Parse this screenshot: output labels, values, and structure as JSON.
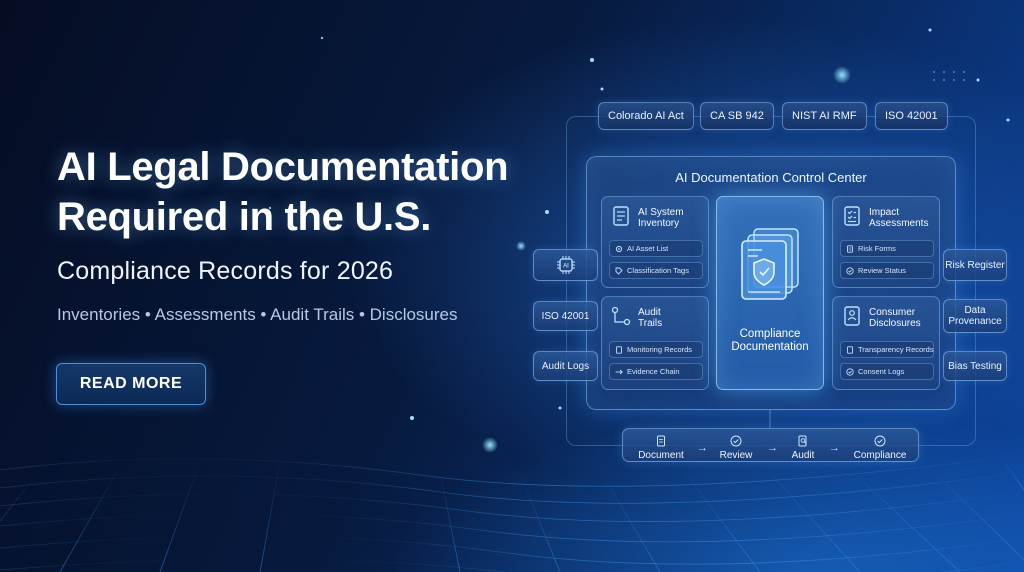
{
  "hero": {
    "title": "AI Legal Documentation Required in the U.S.",
    "subtitle": "Compliance Records for 2026",
    "topics": "Inventories • Assessments • Audit Trails • Disclosures",
    "cta_label": "READ MORE"
  },
  "top_chips": [
    "Colorado AI Act",
    "CA SB 942",
    "NIST AI RMF",
    "ISO 42001"
  ],
  "control_center": {
    "title": "AI Documentation Control Center",
    "cards": {
      "inventory": {
        "title": "AI System Inventory",
        "items": [
          "AI Asset List",
          "Classification Tags"
        ]
      },
      "audit": {
        "title": "Audit Trails",
        "items": [
          "Monitoring Records",
          "Evidence Chain"
        ]
      },
      "impact": {
        "title": "Impact Assessments",
        "items": [
          "Risk Forms",
          "Review Status"
        ]
      },
      "consumer": {
        "title": "Consumer Disclosures",
        "items": [
          "Transparency Records",
          "Consent Logs"
        ]
      }
    },
    "center_label": "Compliance Documentation"
  },
  "left_chips": {
    "chip_icon": "ai-chip-icon",
    "iso": "ISO 42001",
    "audit_logs": "Audit Logs"
  },
  "right_chips": {
    "risk": "Risk Register",
    "provenance": "Data Provenance",
    "bias": "Bias Testing"
  },
  "workflow": {
    "steps": [
      "Document",
      "Review",
      "Audit",
      "Compliance"
    ],
    "arrow": "→"
  },
  "colors": {
    "background_dark": "#050d24",
    "background_blue": "#0d46a0",
    "accent": "#4f8fd8",
    "glow": "#5ab4ff"
  }
}
